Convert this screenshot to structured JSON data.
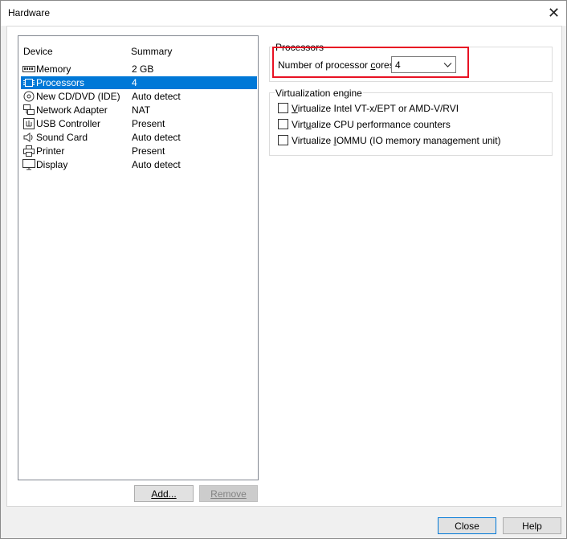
{
  "window": {
    "title": "Hardware"
  },
  "devices": {
    "headers": {
      "device": "Device",
      "summary": "Summary"
    },
    "rows": [
      {
        "icon": "memory-icon",
        "name": "Memory",
        "summary": "2 GB"
      },
      {
        "icon": "processor-icon",
        "name": "Processors",
        "summary": "4",
        "selected": true
      },
      {
        "icon": "cd-dvd-icon",
        "name": "New CD/DVD (IDE)",
        "summary": "Auto detect"
      },
      {
        "icon": "network-adapter-icon",
        "name": "Network Adapter",
        "summary": "NAT"
      },
      {
        "icon": "usb-controller-icon",
        "name": "USB Controller",
        "summary": "Present"
      },
      {
        "icon": "sound-card-icon",
        "name": "Sound Card",
        "summary": "Auto detect"
      },
      {
        "icon": "printer-icon",
        "name": "Printer",
        "summary": "Present"
      },
      {
        "icon": "display-icon",
        "name": "Display",
        "summary": "Auto detect"
      }
    ],
    "add_label": "Add...",
    "remove_label": "Remove"
  },
  "processors": {
    "group_title": "Processors",
    "cores_label_pre": "Number of processor ",
    "cores_label_accel": "c",
    "cores_label_post": "ores:",
    "cores_value": "4"
  },
  "virtualization": {
    "group_title": "Virtualization engine",
    "options": [
      {
        "accel": "V",
        "rest": "irtualize Intel VT-x/EPT or AMD-V/RVI",
        "checked": false
      },
      {
        "pre": "Virt",
        "accel": "u",
        "rest": "alize CPU performance counters",
        "checked": false
      },
      {
        "pre": "Virtualize ",
        "accel": "I",
        "rest": "OMMU (IO memory management unit)",
        "checked": false
      }
    ]
  },
  "footer": {
    "close_label": "Close",
    "help_label": "Help"
  },
  "colors": {
    "selection": "#0078d7",
    "highlight_box": "#e81123"
  }
}
